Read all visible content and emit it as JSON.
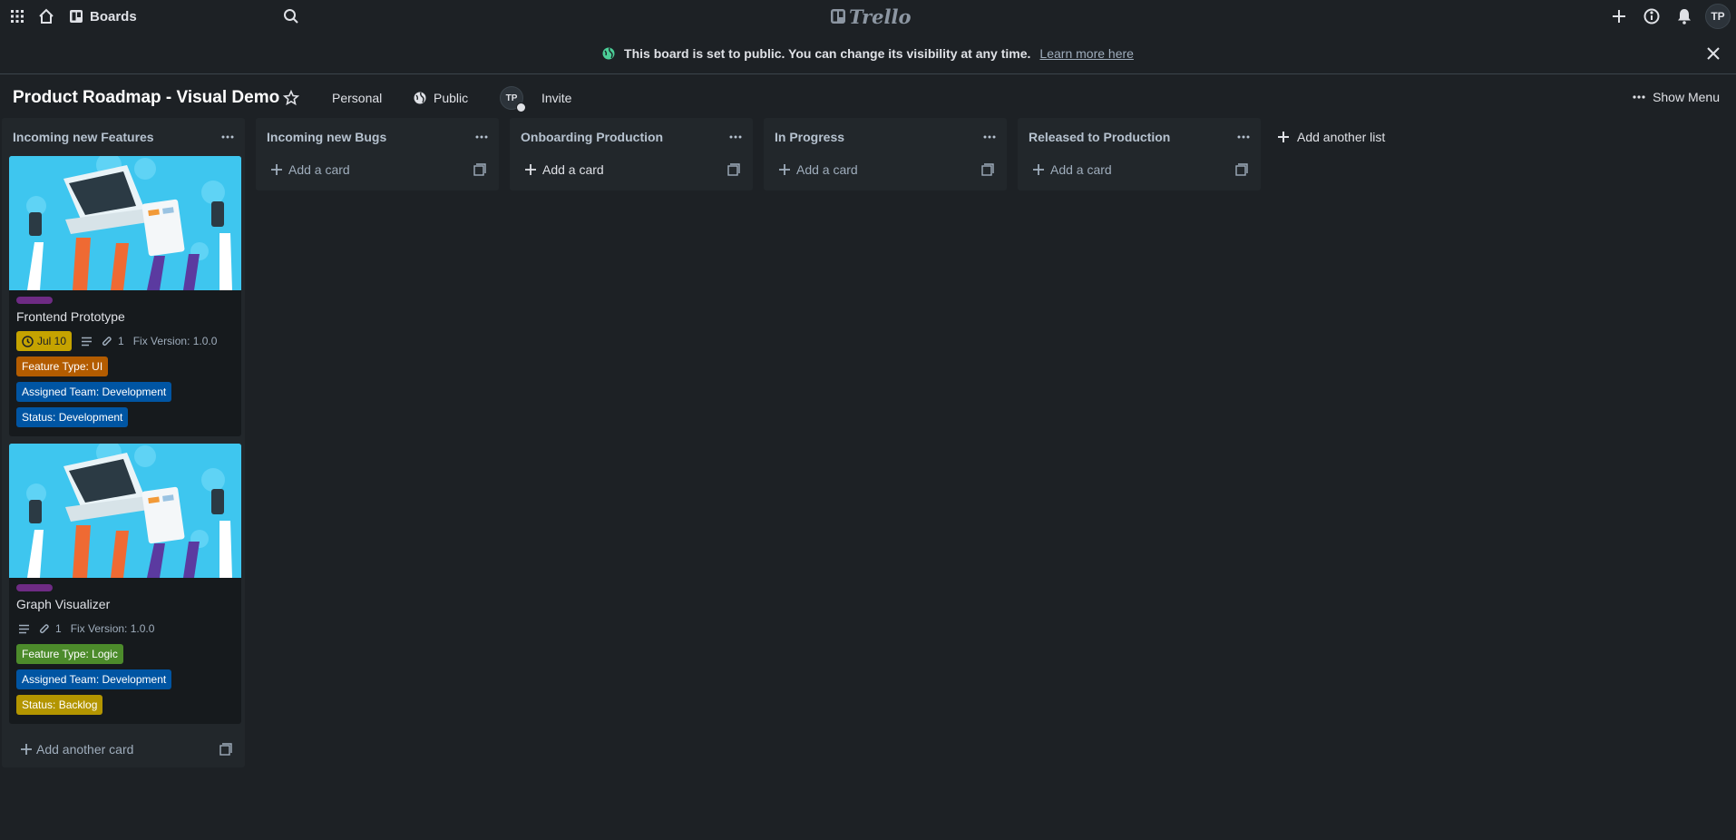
{
  "topnav": {
    "boards_label": "Boards",
    "logo_text": "Trello",
    "avatar_initials": "TP"
  },
  "banner": {
    "message": "This board is set to public. You can change its visibility at any time.",
    "link": "Learn more here"
  },
  "board": {
    "title": "Product Roadmap - Visual Demo",
    "workspace": "Personal",
    "visibility": "Public",
    "member_initials": "TP",
    "invite": "Invite",
    "show_menu": "Show Menu",
    "add_list": "Add another list"
  },
  "lists": [
    {
      "title": "Incoming new Features",
      "footer_add": "Add another card",
      "cards": [
        {
          "title": "Frontend Prototype",
          "due": "Jul 10",
          "attachments": "1",
          "fix_version": "Fix Version: 1.0.0",
          "labels": [
            {
              "text": "Feature Type: UI",
              "color": "#b35c00"
            },
            {
              "text": "Assigned Team: Development",
              "color": "#0055a3"
            },
            {
              "text": "Status: Development",
              "color": "#0055a3"
            }
          ]
        },
        {
          "title": "Graph Visualizer",
          "attachments": "1",
          "fix_version": "Fix Version: 1.0.0",
          "labels": [
            {
              "text": "Feature Type: Logic",
              "color": "#4c8b2b"
            },
            {
              "text": "Assigned Team: Development",
              "color": "#0055a3"
            },
            {
              "text": "Status: Backlog",
              "color": "#b39500"
            }
          ]
        }
      ]
    },
    {
      "title": "Incoming new Bugs",
      "add_card": "Add a card"
    },
    {
      "title": "Onboarding Production",
      "add_card": "Add a card"
    },
    {
      "title": "In Progress",
      "add_card": "Add a card"
    },
    {
      "title": "Released to Production",
      "add_card": "Add a card"
    }
  ],
  "colors": {
    "background": "#1d2125",
    "list_bg": "#22272b",
    "card_bg": "#161a1d",
    "label_purple": "#6e2b84",
    "cover_blue": "#3ec6ef"
  }
}
